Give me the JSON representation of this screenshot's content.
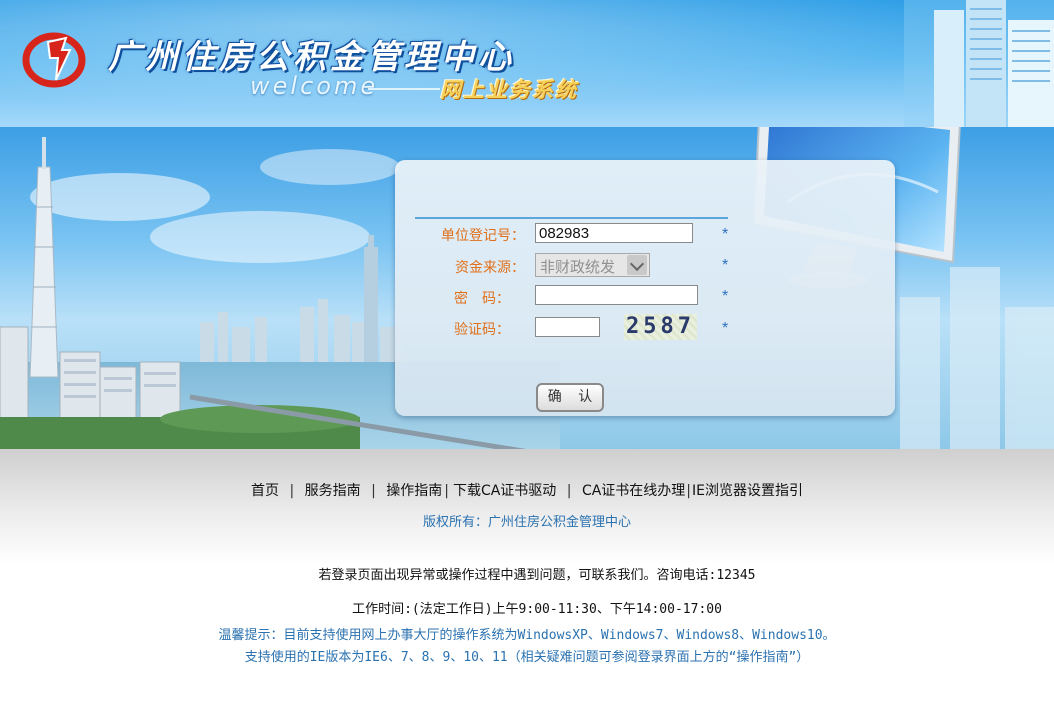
{
  "header": {
    "title": "广州住房公积金管理中心",
    "welcome": "welcome",
    "subtitle": "网上业务系统"
  },
  "login": {
    "unit_label": "单位登记号：",
    "unit_value": "082983",
    "fund_label": "资金来源：",
    "fund_selected": "非财政统发",
    "password_label": "密　码：",
    "password_value": "",
    "captcha_label": "验证码：",
    "captcha_value": "",
    "captcha_image_text": "2587",
    "required_mark": "*",
    "confirm_label": "确 认"
  },
  "footer": {
    "nav": [
      "首页",
      "服务指南",
      "操作指南",
      "下载CA证书驱动",
      "CA证书在线办理",
      "IE浏览器设置指引"
    ],
    "copyright": "版权所有：广州住房公积金管理中心",
    "contact": "若登录页面出现异常或操作过程中遇到问题，可联系我们。咨询电话:12345",
    "hours": "工作时间:(法定工作日)上午9:00-11:30、下午14:00-17:00",
    "tip1": "温馨提示：目前支持使用网上办事大厅的操作系统为WindowsXP、Windows7、Windows8、Windows10。",
    "tip2": "支持使用的IE版本为IE6、7、8、9、10、11（相关疑难问题可参阅登录界面上方的“操作指南”）"
  },
  "colors": {
    "label_orange": "#e0701a",
    "link_blue": "#2b72b0",
    "logo_red": "#d8251c"
  }
}
